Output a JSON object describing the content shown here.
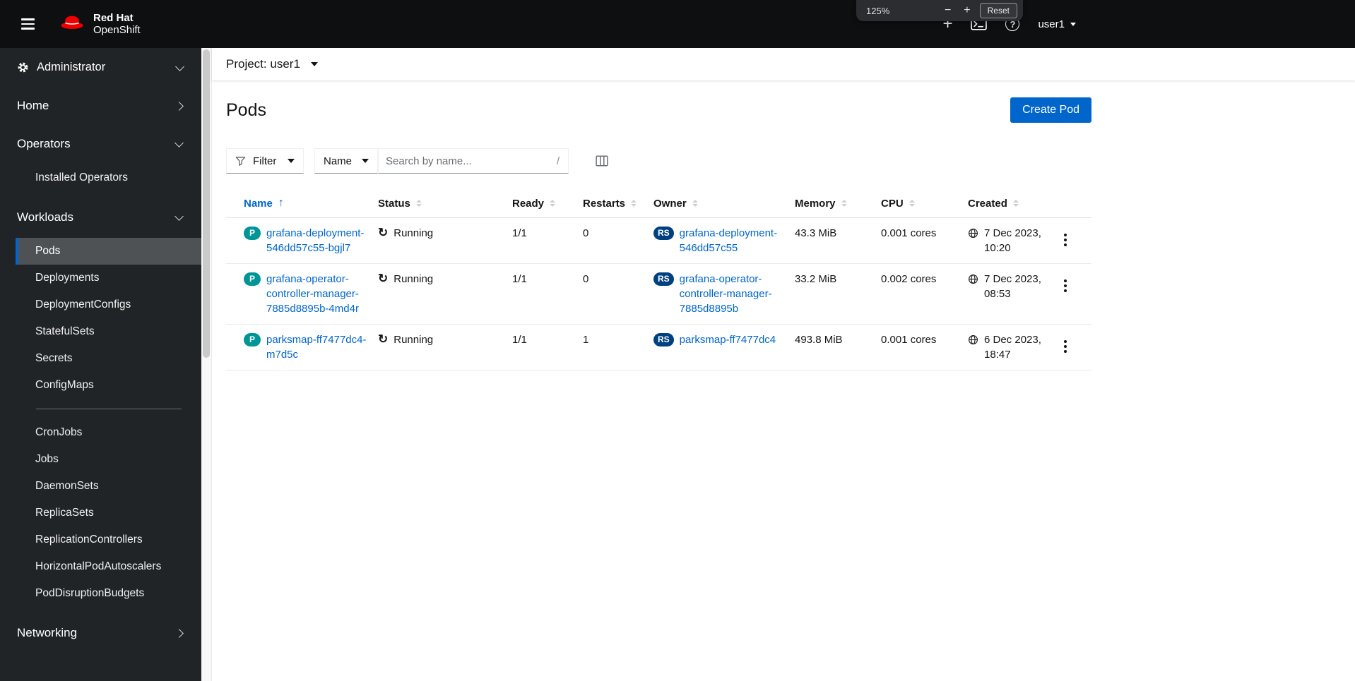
{
  "masthead": {
    "brand_line1": "Red Hat",
    "brand_line2": "OpenShift",
    "user": "user1",
    "zoom": {
      "level": "125%",
      "minus": "−",
      "plus": "+",
      "reset": "Reset"
    }
  },
  "icons": {
    "help": "?",
    "plus": "+",
    "running_sync": "↻",
    "sort_asc": "↑"
  },
  "sidebar": {
    "perspective": "Administrator",
    "items": {
      "home": "Home",
      "operators": "Operators",
      "installed_operators": "Installed Operators",
      "workloads": "Workloads",
      "networking": "Networking"
    },
    "workloads_children": [
      "Pods",
      "Deployments",
      "DeploymentConfigs",
      "StatefulSets",
      "Secrets",
      "ConfigMaps",
      "CronJobs",
      "Jobs",
      "DaemonSets",
      "ReplicaSets",
      "ReplicationControllers",
      "HorizontalPodAutoscalers",
      "PodDisruptionBudgets"
    ]
  },
  "project_bar": {
    "label": "Project:",
    "value": "user1"
  },
  "page": {
    "title": "Pods",
    "create_button": "Create Pod"
  },
  "toolbar": {
    "filter": "Filter",
    "name_filter": "Name",
    "search_placeholder": "Search by name...",
    "search_shortcut": "/"
  },
  "table": {
    "headers": {
      "name": "Name",
      "status": "Status",
      "ready": "Ready",
      "restarts": "Restarts",
      "owner": "Owner",
      "memory": "Memory",
      "cpu": "CPU",
      "created": "Created"
    },
    "rows": [
      {
        "badge": "P",
        "name": "grafana-deployment-546dd57c55-bgjl7",
        "status": "Running",
        "ready": "1/1",
        "restarts": "0",
        "owner_badge": "RS",
        "owner": "grafana-deployment-546dd57c55",
        "memory": "43.3 MiB",
        "cpu": "0.001 cores",
        "created": "7 Dec 2023, 10:20"
      },
      {
        "badge": "P",
        "name": "grafana-operator-controller-manager-7885d8895b-4md4r",
        "status": "Running",
        "ready": "1/1",
        "restarts": "0",
        "owner_badge": "RS",
        "owner": "grafana-operator-controller-manager-7885d8895b",
        "memory": "33.2 MiB",
        "cpu": "0.002 cores",
        "created": "7 Dec 2023, 08:53"
      },
      {
        "badge": "P",
        "name": "parksmap-ff7477dc4-m7d5c",
        "status": "Running",
        "ready": "1/1",
        "restarts": "1",
        "owner_badge": "RS",
        "owner": "parksmap-ff7477dc4",
        "memory": "493.8 MiB",
        "cpu": "0.001 cores",
        "created": "6 Dec 2023, 18:47"
      }
    ]
  },
  "colors": {
    "link": "#0066cc",
    "primary_button": "#0066cc",
    "pod_badge": "#009596",
    "replicaset_badge": "#004080",
    "masthead_bg": "#0e0f10",
    "sidebar_bg": "#212427",
    "nav_active_bg": "#4f5255"
  }
}
